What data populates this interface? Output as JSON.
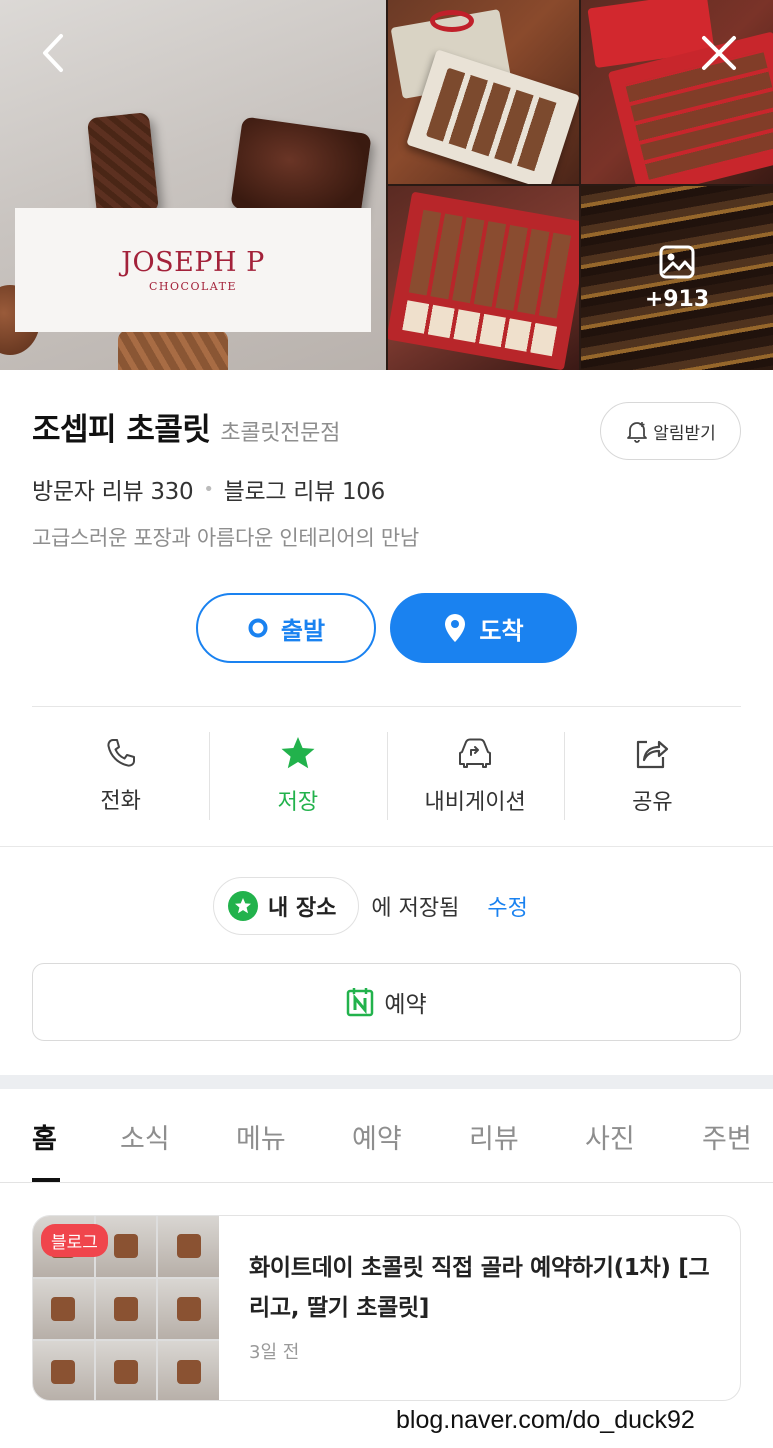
{
  "gallery": {
    "logo_main": "JOSEPH P",
    "logo_sub": "CHOCOLATE",
    "more_count": "+913"
  },
  "place": {
    "name": "조셉피 초콜릿",
    "category": "초콜릿전문점",
    "notify_label": "알림받기",
    "visitor_reviews": "방문자 리뷰 330",
    "blog_reviews": "블로그 리뷰 106",
    "description": "고급스러운 포장과 아름다운 인테리어의 만남"
  },
  "route": {
    "depart": "출발",
    "arrive": "도착"
  },
  "actions": [
    {
      "label": "전화",
      "icon": "phone-icon"
    },
    {
      "label": "저장",
      "icon": "star-icon"
    },
    {
      "label": "내비게이션",
      "icon": "car-icon"
    },
    {
      "label": "공유",
      "icon": "share-icon"
    }
  ],
  "saved": {
    "list_name": "내 장소",
    "status": "에 저장됨",
    "edit": "수정"
  },
  "reserve": {
    "label": "예약"
  },
  "tabs": [
    "홈",
    "소식",
    "메뉴",
    "예약",
    "리뷰",
    "사진",
    "주변"
  ],
  "feed": {
    "badge": "블로그",
    "title": "화이트데이 초콜릿 직접 골라 예약하기(1차) [그리고, 딸기 초콜릿]",
    "time": "3일 전"
  },
  "watermark": "blog.naver.com/do_duck92",
  "colors": {
    "accent": "#1a82f0",
    "saved_green": "#22b24c",
    "badge_red": "#f0454c",
    "brand": "#a3223a"
  }
}
